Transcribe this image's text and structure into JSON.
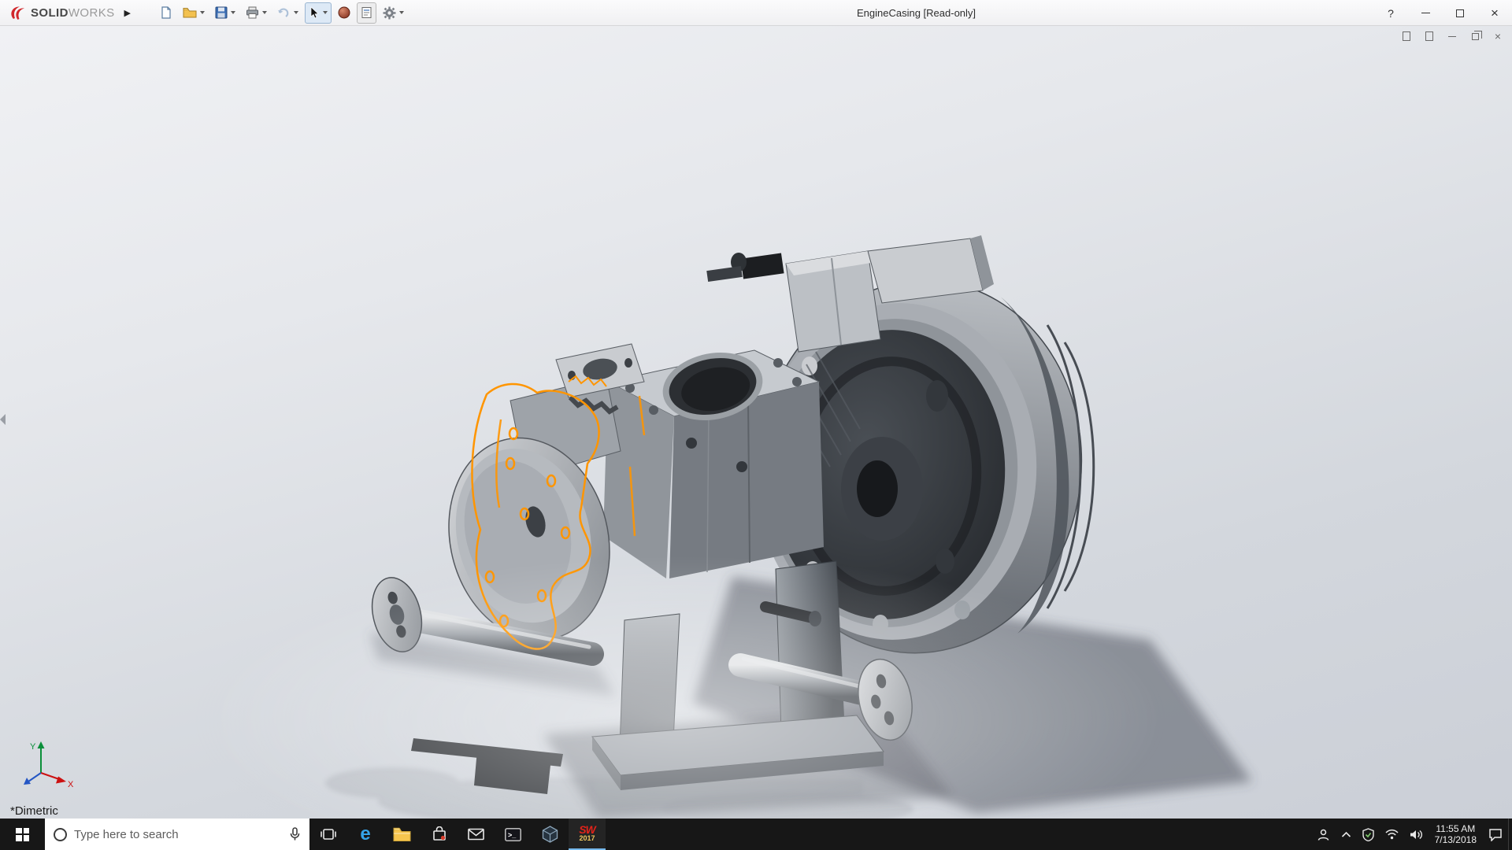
{
  "titlebar": {
    "brand": {
      "solid": "SOLID",
      "works": "WORKS"
    },
    "expander_glyph": "▶",
    "document_title": "EngineCasing [Read-only]",
    "help_glyph": "?",
    "toolbar_icons": [
      "new-document",
      "open",
      "save",
      "print",
      "undo",
      "select",
      "appearances",
      "document-properties",
      "settings"
    ]
  },
  "viewport": {
    "view_orientation_label": "*Dimetric",
    "triad": {
      "x_label": "X",
      "y_label": "Y"
    },
    "colors": {
      "x_axis": "#cc1111",
      "y_axis": "#0b8f3a",
      "z_axis": "#2456c4",
      "sketch_highlight": "#ff9500"
    }
  },
  "taskbar": {
    "search": {
      "placeholder": "Type here to search"
    },
    "apps": [
      "task-view",
      "edge",
      "file-explorer",
      "store",
      "mail",
      "command-prompt",
      "cad-viewer",
      "solidworks-2017"
    ],
    "edge_glyph": "e",
    "cmd_glyph": ">_",
    "sw_label": "SW",
    "sw_year": "2017",
    "clock": {
      "time": "11:55 AM",
      "date": "7/13/2018"
    }
  }
}
